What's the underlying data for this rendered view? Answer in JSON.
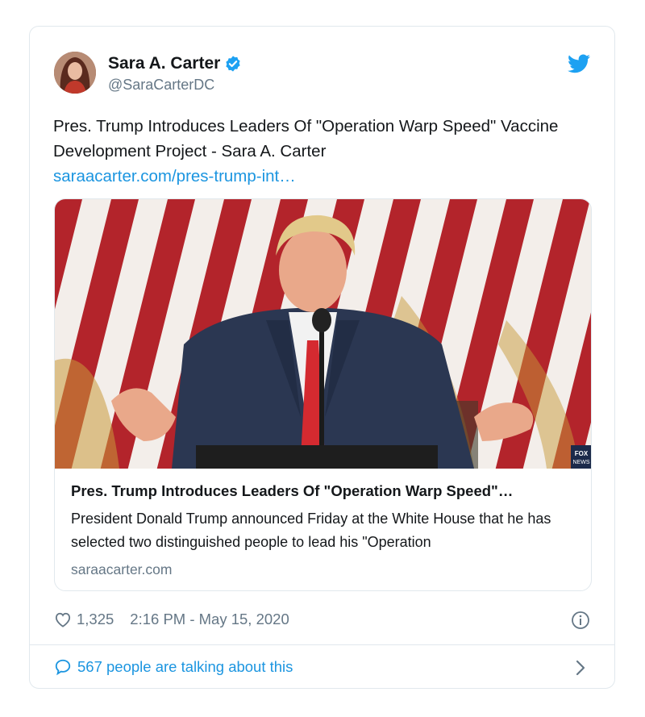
{
  "author": {
    "name": "Sara A. Carter",
    "handle": "@SaraCarterDC",
    "verified": true,
    "avatar_icon": "avatar-photo"
  },
  "tweet": {
    "text": "Pres. Trump Introduces Leaders Of \"Operation Warp Speed\" Vaccine Development Project - Sara A. Carter",
    "link_text": "saraacarter.com/pres-trump-int…"
  },
  "link_card": {
    "image_badge": "FOX NEWS",
    "title": "Pres. Trump Introduces Leaders Of \"Operation Warp Speed\"…",
    "description": "President Donald Trump announced Friday at the White House that he has selected two distinguished people to lead his \"Operation",
    "domain": "saraacarter.com"
  },
  "footer": {
    "like_count": "1,325",
    "timestamp": "2:16 PM - May 15, 2020",
    "talking": "567 people are talking about this"
  },
  "colors": {
    "accent": "#1b95e0",
    "muted": "#657786",
    "border": "#e1e8ed",
    "twitter_blue": "#1da1f2"
  },
  "icons": [
    "verified-badge-icon",
    "twitter-bird-icon",
    "heart-icon",
    "info-icon",
    "chat-bubble-icon",
    "chevron-right-icon"
  ]
}
